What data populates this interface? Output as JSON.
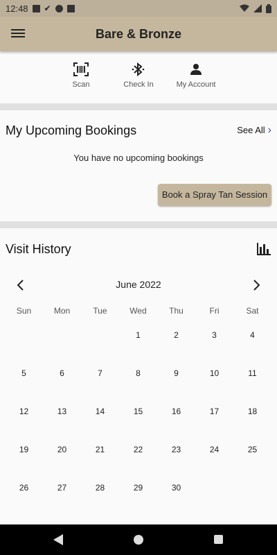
{
  "status_bar": {
    "time": "12:48"
  },
  "app_bar": {
    "title": "Bare & Bronze"
  },
  "quick_actions": [
    {
      "label": "Scan",
      "icon": "barcode-scan-icon"
    },
    {
      "label": "Check In",
      "icon": "bluetooth-icon"
    },
    {
      "label": "My Account",
      "icon": "person-icon"
    }
  ],
  "bookings": {
    "title": "My Upcoming Bookings",
    "see_all": "See All",
    "empty_message": "You have no upcoming bookings",
    "book_button": "Book a Spray Tan Session"
  },
  "history": {
    "title": "Visit History",
    "month": "June 2022",
    "weekdays": [
      "Sun",
      "Mon",
      "Tue",
      "Wed",
      "Thu",
      "Fri",
      "Sat"
    ],
    "days": [
      "1",
      "2",
      "3",
      "4",
      "5",
      "6",
      "7",
      "8",
      "9",
      "10",
      "11",
      "12",
      "13",
      "14",
      "15",
      "16",
      "17",
      "18",
      "19",
      "20",
      "21",
      "22",
      "23",
      "24",
      "25",
      "26",
      "27",
      "28",
      "29",
      "30"
    ]
  },
  "colors": {
    "accent": "#c5b79d",
    "status_bar": "#bdb09a",
    "link": "#3f51b5"
  }
}
